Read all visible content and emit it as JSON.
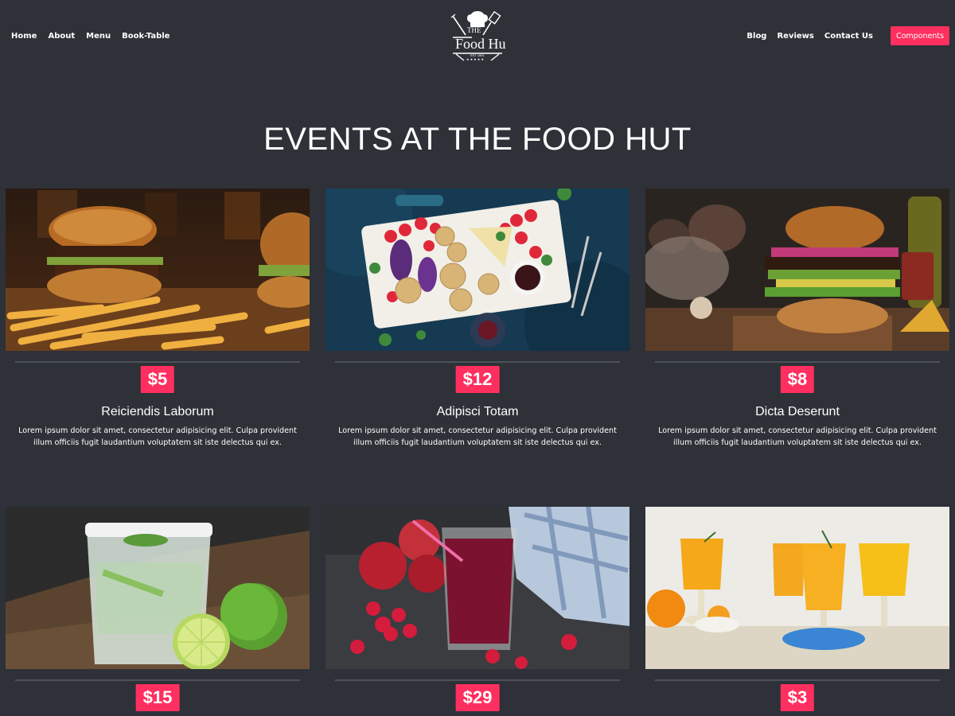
{
  "nav": {
    "left": [
      "Home",
      "About",
      "Menu",
      "Book-Table"
    ],
    "right": [
      "Blog",
      "Reviews",
      "Contact Us"
    ],
    "components_button": "Components"
  },
  "logo": {
    "line1": "THE",
    "line2": "Food Hu",
    "line3": "EST 1991",
    "stars": "★★★★★"
  },
  "heading": "EVENTS AT THE FOOD HUT",
  "colors": {
    "background": "#2e3138",
    "accent": "#ff2f5f",
    "text": "#ffffff"
  },
  "cards": [
    {
      "image": "burger-and-fries-photo",
      "price": "$5",
      "title": "Reiciendis Laborum",
      "description": "Lorem ipsum dolor sit amet, consectetur adipisicing elit. Culpa provident illum officiis fugit laudantium voluptatem sit iste delectus qui ex."
    },
    {
      "image": "snack-platter-photo",
      "price": "$12",
      "title": "Adipisci Totam",
      "description": "Lorem ipsum dolor sit amet, consectetur adipisicing elit. Culpa provident illum officiis fugit laudantium voluptatem sit iste delectus qui ex."
    },
    {
      "image": "gourmet-burger-photo",
      "price": "$8",
      "title": "Dicta Deserunt",
      "description": "Lorem ipsum dolor sit amet, consectetur adipisicing elit. Culpa provident illum officiis fugit laudantium voluptatem sit iste delectus qui ex."
    },
    {
      "image": "lime-cocktail-photo",
      "price": "$15",
      "title": "",
      "description": ""
    },
    {
      "image": "berry-smoothie-photo",
      "price": "$29",
      "title": "",
      "description": ""
    },
    {
      "image": "orange-drinks-photo",
      "price": "$3",
      "title": "",
      "description": ""
    }
  ]
}
